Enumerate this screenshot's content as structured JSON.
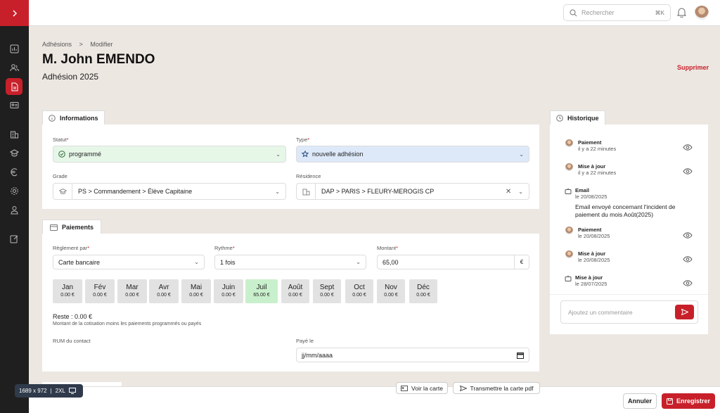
{
  "topbar": {
    "search_placeholder": "Rechercher",
    "search_shortcut": "⌘K"
  },
  "breadcrumb": {
    "parent": "Adhésions",
    "separator": ">",
    "current": "Modifier"
  },
  "page": {
    "title": "M. John EMENDO",
    "subtitle": "Adhésion 2025",
    "delete_label": "Supprimer"
  },
  "informations": {
    "tab_label": "Informations",
    "statut_label": "Statut",
    "statut_value": "programmé",
    "type_label": "Type",
    "type_value": "nouvelle adhésion",
    "grade_label": "Grade",
    "grade_value": "PS > Commandement > Élève Capitaine",
    "residence_label": "Résidence",
    "residence_value": "DAP > PARIS > FLEURY-MEROGIS CP"
  },
  "paiements": {
    "tab_label": "Paiements",
    "reglement_label": "Règlement par",
    "reglement_value": "Carte bancaire",
    "rythme_label": "Rythme",
    "rythme_value": "1 fois",
    "montant_label": "Montant",
    "montant_value": "65,00",
    "currency": "€",
    "months": [
      {
        "name": "Jan",
        "amount": "0.00 €"
      },
      {
        "name": "Fév",
        "amount": "0.00 €"
      },
      {
        "name": "Mar",
        "amount": "0.00 €"
      },
      {
        "name": "Avr",
        "amount": "0.00 €"
      },
      {
        "name": "Mai",
        "amount": "0.00 €"
      },
      {
        "name": "Juin",
        "amount": "0.00 €"
      },
      {
        "name": "Juil",
        "amount": "65.00 €"
      },
      {
        "name": "Août",
        "amount": "0.00 €"
      },
      {
        "name": "Sept",
        "amount": "0.00 €"
      },
      {
        "name": "Oct",
        "amount": "0.00 €"
      },
      {
        "name": "Nov",
        "amount": "0.00 €"
      },
      {
        "name": "Déc",
        "amount": "0.00 €"
      }
    ],
    "reste": "Reste : 0.00 €",
    "reste_note": "Montant de la cotisation moins les paiements programmés ou payés",
    "rum_label": "RUM du contact",
    "paye_label": "Payé le",
    "paye_placeholder": "jj/mm/aaaa"
  },
  "historique": {
    "tab_label": "Historique",
    "items": [
      {
        "title": "Paiement",
        "time": "il y a 22 minutes"
      },
      {
        "title": "Mise à jour",
        "time": "il y a 22 minutes"
      },
      {
        "title": "Email",
        "time": "le 20/08/2025",
        "body": "Email envoyé concernant l'incident de paiement du mois Août(2025)"
      },
      {
        "title": "Paiement",
        "time": "le 20/08/2025"
      },
      {
        "title": "Mise à jour",
        "time": "le 20/08/2025"
      },
      {
        "title": "Mise à jour",
        "time": "le 28/07/2025"
      }
    ],
    "comment_placeholder": "Ajoutez un commentaire"
  },
  "footer": {
    "voir_carte": "Voir la carte",
    "transmettre": "Transmettre la carte pdf",
    "annuler": "Annuler",
    "enregistrer": "Enregistrer"
  },
  "viewport_badge": {
    "size": "1689 x 972",
    "breakpoint": "2XL"
  },
  "colors": {
    "brand": "#c8202a",
    "sidebar": "#1f1f1f",
    "statut_bg": "#e6f7e8",
    "type_bg": "#dde9f9"
  }
}
